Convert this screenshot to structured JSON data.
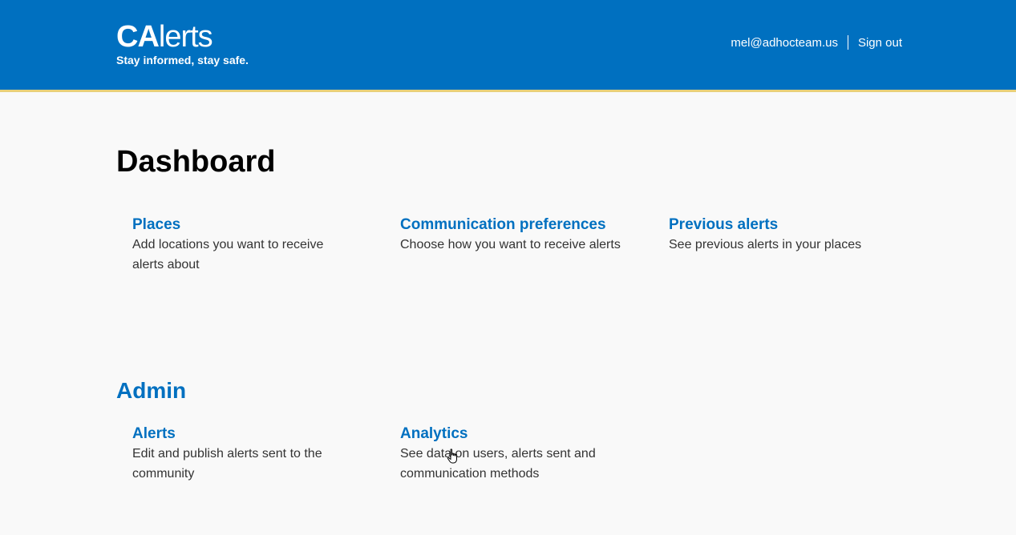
{
  "header": {
    "logo_ca": "CA",
    "logo_rest": "lerts",
    "tagline": "Stay informed, stay safe.",
    "email": "mel@adhocteam.us",
    "signout_label": "Sign out"
  },
  "main": {
    "title": "Dashboard",
    "cards": [
      {
        "title": "Places",
        "description": "Add locations you want to receive alerts about"
      },
      {
        "title": "Communication preferences",
        "description": "Choose how you want to receive alerts"
      },
      {
        "title": "Previous alerts",
        "description": "See previous alerts in your places"
      }
    ]
  },
  "admin": {
    "title": "Admin",
    "cards": [
      {
        "title": "Alerts",
        "description": "Edit and publish alerts sent to the community"
      },
      {
        "title": "Analytics",
        "description": "See data on users, alerts sent and communication methods"
      }
    ]
  },
  "colors": {
    "header_bg": "#0070c0",
    "accent_border": "#e8d07a",
    "link": "#0070c0",
    "page_bg": "#f9f9f9"
  }
}
